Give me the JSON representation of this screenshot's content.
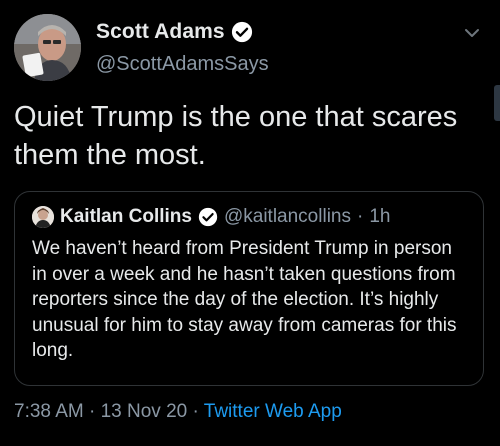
{
  "author": {
    "display_name": "Scott Adams",
    "handle": "@ScottAdamsSays",
    "verified": true
  },
  "tweet": {
    "text": "Quiet Trump is the one that scares them the most."
  },
  "quoted_tweet": {
    "author_name": "Kaitlan Collins",
    "author_handle": "@kaitlancollins",
    "separator": "·",
    "time": "1h",
    "verified": true,
    "text": "We haven’t heard from President Trump in person in over a week and he hasn’t taken questions from reporters since the day of the election. It’s highly unusual for him to stay away from cameras for this long."
  },
  "footer": {
    "time": "7:38 AM",
    "separator_1": "·",
    "date": "13 Nov 20",
    "separator_2": "·",
    "source": "Twitter Web App"
  },
  "icons": {
    "verified": "verified-badge-icon",
    "caret": "chevron-down-icon"
  },
  "colors": {
    "background": "#000000",
    "primary_text": "#e7e9ea",
    "secondary_text": "#8b98a5",
    "link": "#1d9bf0",
    "border": "#2f3336"
  }
}
